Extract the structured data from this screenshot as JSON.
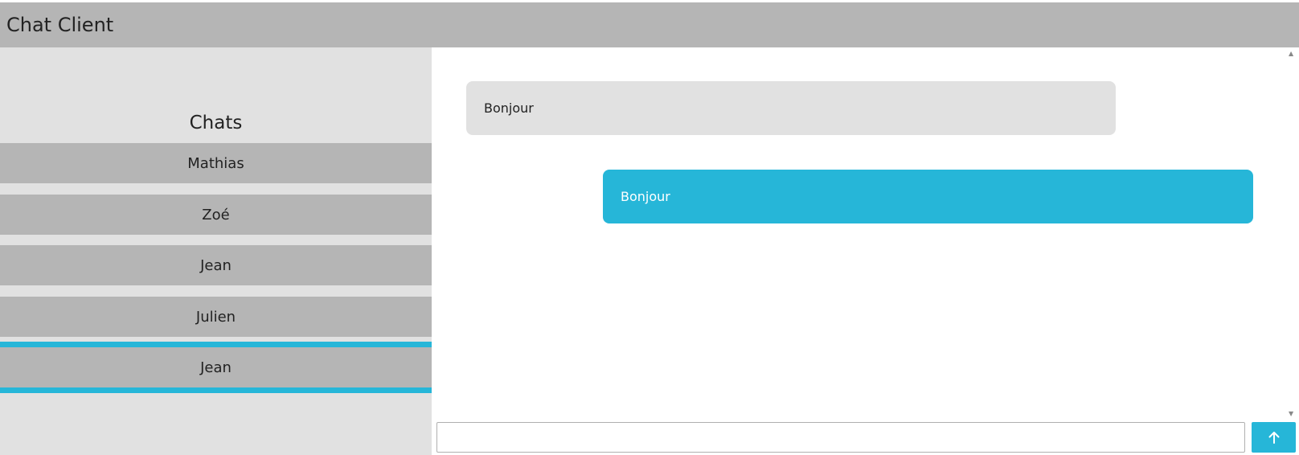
{
  "app": {
    "title": "Chat Client"
  },
  "sidebar": {
    "title": "Chats",
    "items": [
      {
        "label": "Mathias"
      },
      {
        "label": "Zoé"
      },
      {
        "label": "Jean"
      },
      {
        "label": "Julien"
      },
      {
        "label": "Jean",
        "active": true
      }
    ]
  },
  "messages": [
    {
      "text": "Bonjour",
      "direction": "received"
    },
    {
      "text": "Bonjour",
      "direction": "sent"
    }
  ],
  "composer": {
    "value": "",
    "placeholder": "",
    "send_icon": "arrow-up-icon"
  },
  "colors": {
    "accent": "#26b6d8",
    "header_bg": "#b5b5b5",
    "sidebar_bg": "#e1e1e1",
    "item_bg": "#b5b5b5",
    "received_bubble": "#e1e1e1"
  }
}
